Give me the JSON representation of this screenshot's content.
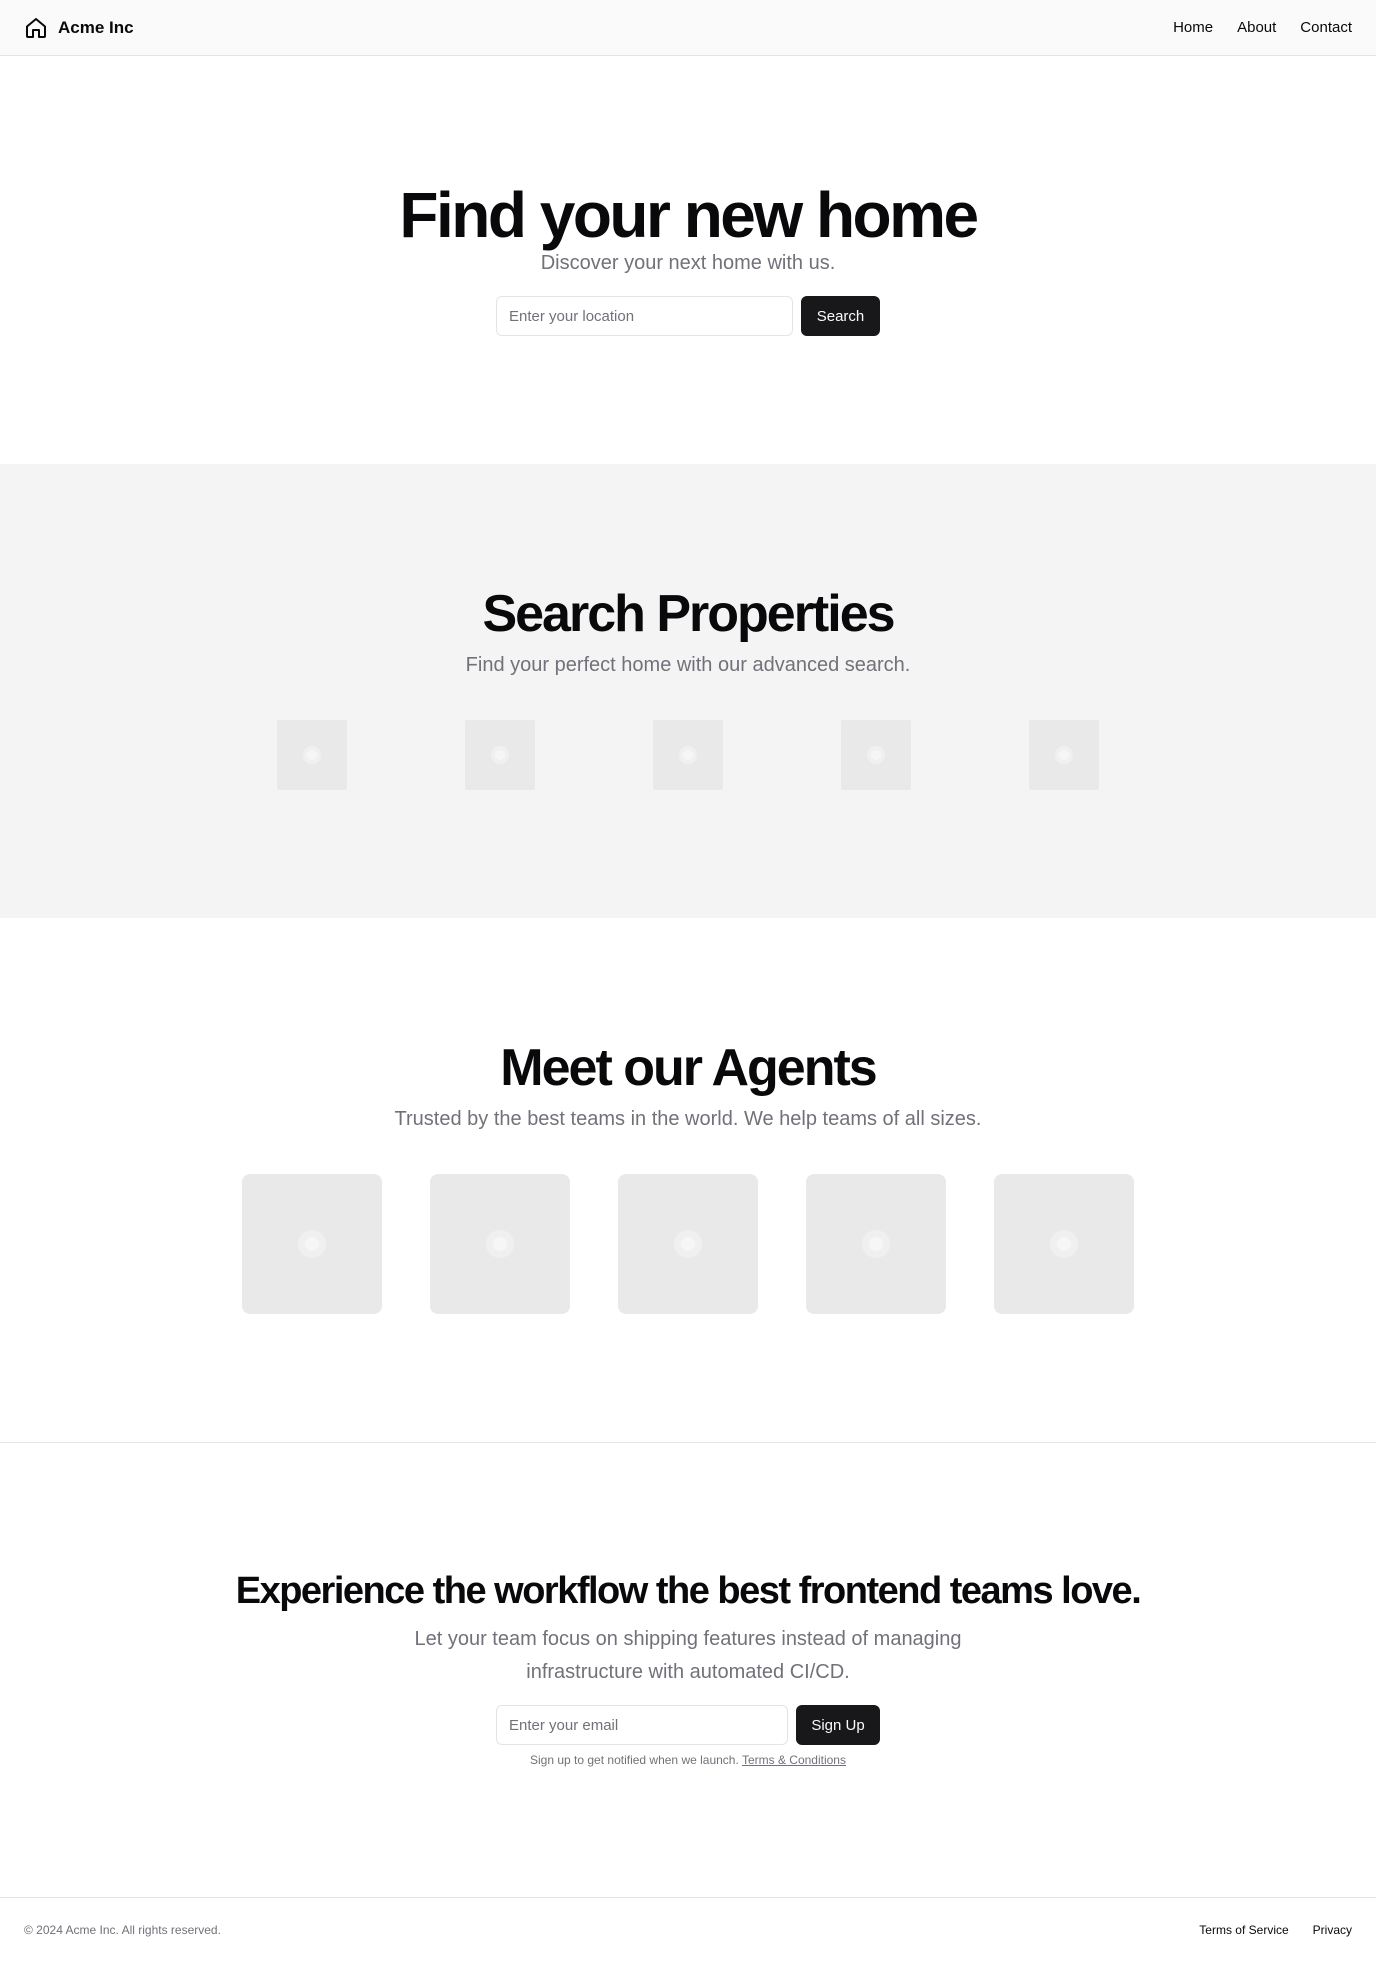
{
  "header": {
    "brand_name": "Acme Inc",
    "brand_icon": "home-icon",
    "nav": [
      "Home",
      "About",
      "Contact"
    ]
  },
  "hero": {
    "title": "Find your new home",
    "subtitle": "Discover your next home with us.",
    "input_placeholder": "Enter your location",
    "button_label": "Search"
  },
  "properties": {
    "title": "Search Properties",
    "subtitle": "Find your perfect home with our advanced search.",
    "thumbnail_count": 5
  },
  "agents": {
    "title": "Meet our Agents",
    "subtitle": "Trusted by the best teams in the world. We help teams of all sizes.",
    "thumbnail_count": 5
  },
  "cta": {
    "title": "Experience the workflow the best frontend teams love.",
    "subtitle": "Let your team focus on shipping features instead of managing infrastructure with automated CI/CD.",
    "input_placeholder": "Enter your email",
    "button_label": "Sign Up",
    "note_text": "Sign up to get notified when we launch.",
    "note_link": "Terms & Conditions"
  },
  "footer": {
    "copyright": "© 2024 Acme Inc. All rights reserved.",
    "links": [
      "Terms of Service",
      "Privacy"
    ]
  },
  "colors": {
    "primary": "#18181b",
    "muted_text": "#71717a",
    "section_bg": "#f4f4f5",
    "border": "#e4e4e7"
  }
}
